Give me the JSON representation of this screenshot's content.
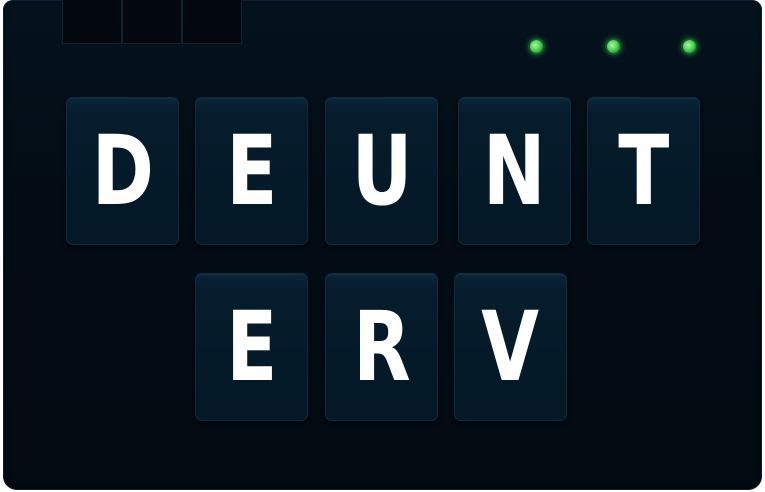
{
  "board": {
    "row1": [
      "D",
      "E",
      "U",
      "N",
      "T"
    ],
    "row2": [
      "E",
      "R",
      "V"
    ]
  },
  "indicators": {
    "count": 3,
    "color": "#4fd455"
  },
  "colors": {
    "panel": "#030c14",
    "tile": "#061c2c",
    "letter": "#ffffff"
  }
}
